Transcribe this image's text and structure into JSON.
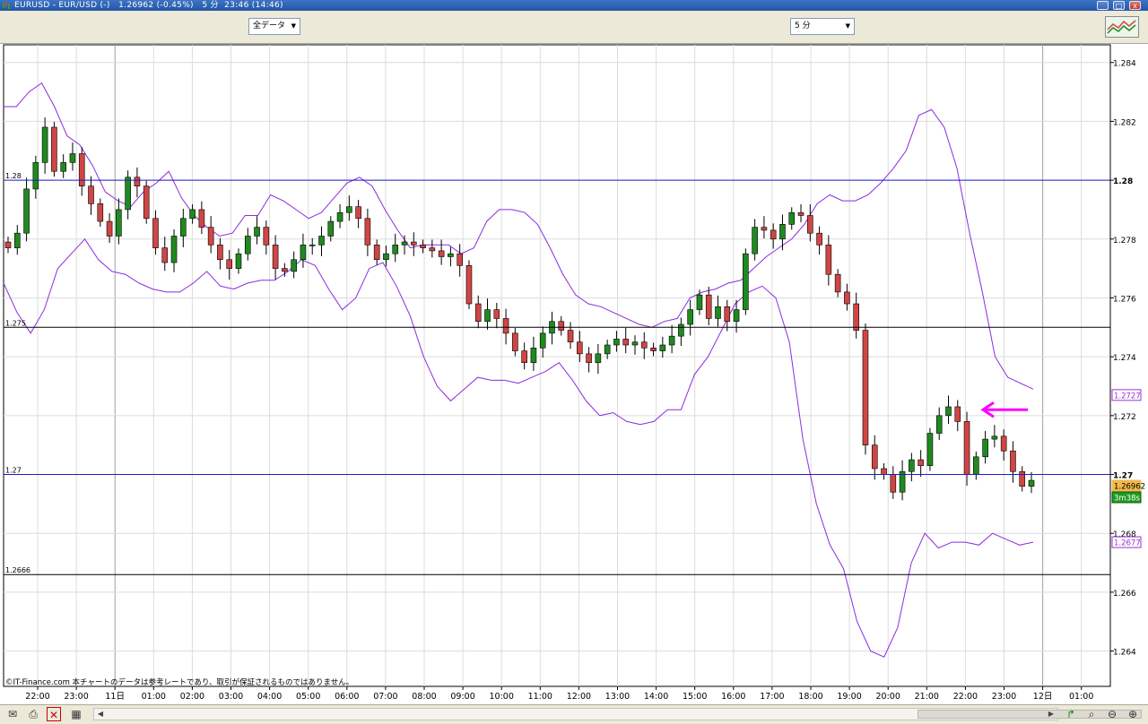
{
  "window": {
    "title": "EURUSD - EUR/USD (-)   1.26962 (-0.45%)   5 分  23:46 (14:46)",
    "buttons": [
      "_",
      "□",
      "x"
    ]
  },
  "toolbar": {
    "data_range_select": "全データ",
    "timeframe_select": "5 分"
  },
  "chart_data": {
    "type": "candlestick",
    "symbol": "EURUSD",
    "timeframe": "5 分",
    "y_axis": {
      "min": 1.2628,
      "max": 1.2846,
      "tick_labels": [
        "1.284",
        "1.282",
        "1.28",
        "1.278",
        "1.276",
        "1.274",
        "1.272",
        "1.27",
        "1.268",
        "1.266",
        "1.264"
      ],
      "tick_values": [
        1.284,
        1.282,
        1.28,
        1.278,
        1.276,
        1.274,
        1.272,
        1.27,
        1.268,
        1.266,
        1.264
      ]
    },
    "x_axis": {
      "tick_labels": [
        "22:00",
        "23:00",
        "11日",
        "01:00",
        "02:00",
        "03:00",
        "04:00",
        "05:00",
        "06:00",
        "07:00",
        "08:00",
        "09:00",
        "10:00",
        "11:00",
        "12:00",
        "13:00",
        "14:00",
        "15:00",
        "16:00",
        "17:00",
        "18:00",
        "19:00",
        "20:00",
        "21:00",
        "22:00",
        "23:00",
        "12日",
        "01:00"
      ]
    },
    "horizontal_lines": [
      {
        "value": 1.28,
        "label": "1.28",
        "color": "#1c1cc8"
      },
      {
        "value": 1.275,
        "label": "1.275",
        "color": "#000000"
      },
      {
        "value": 1.27,
        "label": "1.27",
        "color": "#1c1cc8"
      },
      {
        "value": 1.2666,
        "label": "1.2666",
        "color": "#000000"
      }
    ],
    "price_tags": [
      {
        "value": 1.2727,
        "label": "1.2727",
        "color": "#9b30d0"
      },
      {
        "value": 1.26962,
        "label": "1.26962",
        "color": "#f2b84b"
      },
      {
        "value": 1.2677,
        "label": "1.2677",
        "color": "#9b30d0"
      }
    ],
    "countdown_label": "3m38s",
    "close_series": [
      1.2777,
      1.2782,
      1.2797,
      1.2806,
      1.2818,
      1.2803,
      1.2806,
      1.2809,
      1.2798,
      1.2792,
      1.2786,
      1.2781,
      1.279,
      1.2801,
      1.2798,
      1.2787,
      1.2777,
      1.2772,
      1.2781,
      1.2787,
      1.279,
      1.2784,
      1.2778,
      1.2773,
      1.277,
      1.2775,
      1.2781,
      1.2784,
      1.2778,
      1.277,
      1.2769,
      1.2773,
      1.2778,
      1.2778,
      1.2781,
      1.2786,
      1.2789,
      1.2791,
      1.2787,
      1.2778,
      1.2773,
      1.2775,
      1.2778,
      1.2779,
      1.2778,
      1.2777,
      1.2776,
      1.2774,
      1.2775,
      1.2771,
      1.2758,
      1.2752,
      1.2756,
      1.2753,
      1.2748,
      1.2742,
      1.2738,
      1.2743,
      1.2748,
      1.2752,
      1.2749,
      1.2745,
      1.2741,
      1.2738,
      1.2741,
      1.2744,
      1.2746,
      1.2744,
      1.2745,
      1.2743,
      1.2742,
      1.2744,
      1.2747,
      1.2751,
      1.2756,
      1.2761,
      1.2753,
      1.2757,
      1.2752,
      1.2756,
      1.2775,
      1.2784,
      1.2783,
      1.278,
      1.2785,
      1.2789,
      1.2788,
      1.2782,
      1.2778,
      1.2768,
      1.2762,
      1.2758,
      1.2749,
      1.271,
      1.2702,
      1.27,
      1.2694,
      1.2701,
      1.2705,
      1.2703,
      1.2714,
      1.272,
      1.2723,
      1.2718,
      1.27,
      1.2706,
      1.2712,
      1.2713,
      1.2708,
      1.2701,
      1.2696,
      1.2698
    ],
    "upper_band": [
      1.2825,
      1.2825,
      1.283,
      1.2833,
      1.2825,
      1.2815,
      1.2812,
      1.2805,
      1.2796,
      1.2793,
      1.2791,
      1.2796,
      1.2799,
      1.2803,
      1.2794,
      1.2788,
      1.2784,
      1.2781,
      1.2782,
      1.2788,
      1.2788,
      1.2795,
      1.2793,
      1.279,
      1.2787,
      1.2789,
      1.2794,
      1.2799,
      1.2801,
      1.2798,
      1.279,
      1.2783,
      1.2777,
      1.2778,
      1.2778,
      1.2778,
      1.2775,
      1.2777,
      1.2786,
      1.279,
      1.279,
      1.2789,
      1.2785,
      1.2777,
      1.2768,
      1.2761,
      1.2758,
      1.2757,
      1.2755,
      1.2753,
      1.2751,
      1.275,
      1.2752,
      1.2753,
      1.276,
      1.2762,
      1.2763,
      1.2765,
      1.2766,
      1.277,
      1.2774,
      1.2777,
      1.278,
      1.2785,
      1.2792,
      1.2795,
      1.2793,
      1.2793,
      1.2795,
      1.2799,
      1.2804,
      1.281,
      1.2822,
      1.2824,
      1.2818,
      1.2804,
      1.2782,
      1.2762,
      1.274,
      1.2733,
      1.2731,
      1.2729
    ],
    "lower_band": [
      1.2765,
      1.2755,
      1.2748,
      1.2756,
      1.277,
      1.2775,
      1.278,
      1.2773,
      1.2769,
      1.2768,
      1.2765,
      1.2763,
      1.2762,
      1.2762,
      1.2765,
      1.2769,
      1.2764,
      1.2763,
      1.2765,
      1.2766,
      1.2766,
      1.2769,
      1.2773,
      1.2771,
      1.2763,
      1.2756,
      1.276,
      1.277,
      1.2772,
      1.2764,
      1.2754,
      1.274,
      1.273,
      1.2725,
      1.2729,
      1.2733,
      1.2732,
      1.2732,
      1.2731,
      1.2733,
      1.2735,
      1.2738,
      1.2732,
      1.2725,
      1.272,
      1.2721,
      1.2718,
      1.2717,
      1.2718,
      1.2722,
      1.2722,
      1.2734,
      1.274,
      1.2749,
      1.2758,
      1.2762,
      1.2764,
      1.276,
      1.2745,
      1.2712,
      1.269,
      1.2676,
      1.2668,
      1.265,
      1.264,
      1.2638,
      1.2648,
      1.267,
      1.268,
      1.2675,
      1.2677,
      1.2677,
      1.2676,
      1.268,
      1.2678,
      1.2676,
      1.2677
    ]
  },
  "annotations": {
    "arrow_color": "#ff00ff",
    "copyright": "©IT-Finance.com  本チャートのデータは参考レートであり、取引が保証されるものではありません。"
  },
  "colors": {
    "bull_candle": "#1f8a1f",
    "bear_candle": "#d04545",
    "band": "#8a2be2",
    "grid": "#dcdcdc"
  },
  "icons": [
    "mail-icon",
    "print-icon",
    "crosshair-icon",
    "calc-icon",
    "zoom-fit-icon",
    "zoom-out-icon",
    "zoom-in-icon"
  ]
}
